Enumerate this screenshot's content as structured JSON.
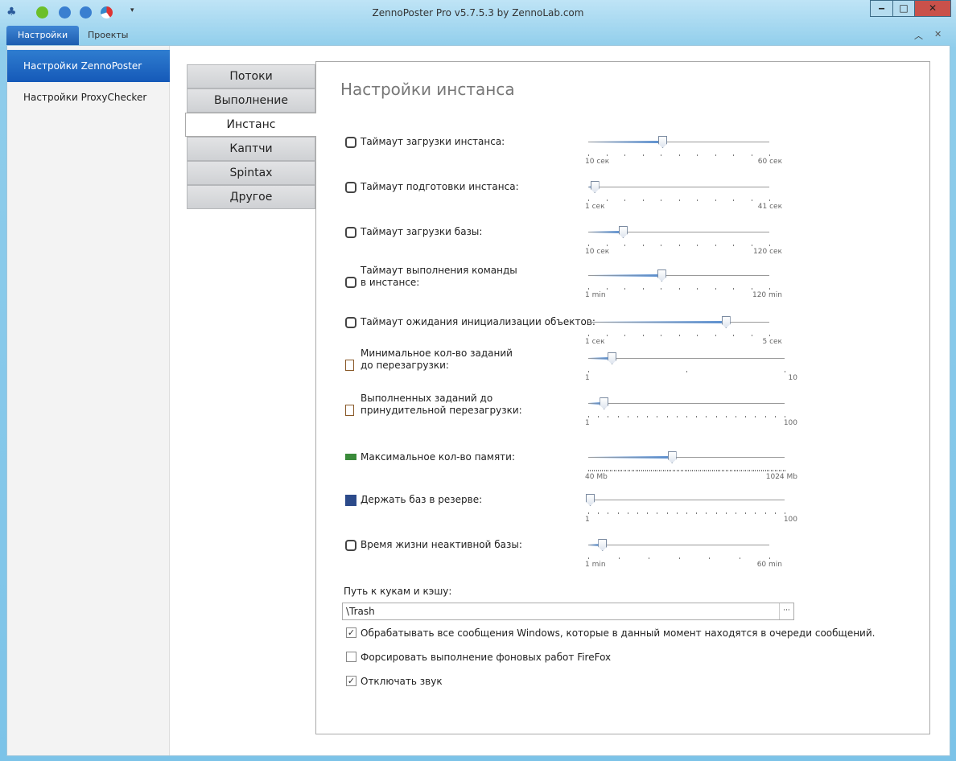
{
  "window": {
    "title": "ZennoPoster Pro v5.7.5.3 by ZennoLab.com",
    "minimize": "‒",
    "maximize": "□",
    "close": "✕"
  },
  "ribbon": {
    "tabs": [
      {
        "label": "Настройки",
        "active": true
      },
      {
        "label": "Проекты",
        "active": false
      }
    ],
    "collapse": "︿",
    "close": "✕"
  },
  "sidebar": {
    "items": [
      {
        "label": "Настройки ZennoPoster",
        "active": true
      },
      {
        "label": "Настройки ProxyChecker",
        "active": false
      }
    ]
  },
  "tabs": [
    {
      "label": "Потоки"
    },
    {
      "label": "Выполнение"
    },
    {
      "label": "Инстанс",
      "active": true
    },
    {
      "label": "Каптчи"
    },
    {
      "label": "Spintax"
    },
    {
      "label": "Другое"
    }
  ],
  "panel": {
    "title": "Настройки инстанса",
    "sliders": [
      {
        "label": "Таймаут загрузки инстанса:",
        "icon": "clock-icon",
        "min_label": "10 сек",
        "max_label": "60 сек",
        "min": 10,
        "max": 60,
        "value": 30
      },
      {
        "label": "Таймаут подготовки инстанса:",
        "icon": "clock-icon",
        "min_label": "1 сек",
        "max_label": "41 сек",
        "min": 1,
        "max": 41,
        "value": 2
      },
      {
        "label": "Таймаут загрузки базы:",
        "icon": "clock-icon",
        "min_label": "10 сек",
        "max_label": "120 сек",
        "min": 10,
        "max": 120,
        "value": 30
      },
      {
        "label": "Таймаут выполнения команды\nв инстансе:",
        "icon": "clock-icon",
        "min_label": "1 min",
        "max_label": "120 min",
        "min": 1,
        "max": 120,
        "value": 48
      },
      {
        "label": "Таймаут ожидания инициализации объектов:",
        "icon": "clock-icon",
        "min_label": "1 сек",
        "max_label": "5 сек",
        "min": 1,
        "max": 5,
        "value": 4
      },
      {
        "label": "Минимальное кол-во заданий\nдо перезагрузки:",
        "icon": "clipboard-icon",
        "min_label": "1",
        "max_label": "10",
        "min": 1,
        "max": 10,
        "value": 2
      },
      {
        "label": "Выполненных заданий до\nпринудительной перезагрузки:",
        "icon": "clipboard-icon",
        "min_label": "1",
        "max_label": "100",
        "min": 1,
        "max": 100,
        "value": 8
      },
      {
        "label": "Максимальное кол-во памяти:",
        "icon": "memory-icon",
        "min_label": "40 Mb",
        "max_label": "1024 Mb",
        "min": 40,
        "max": 1024,
        "value": 450
      },
      {
        "label": "Держать баз в резерве:",
        "icon": "database-icon",
        "min_label": "1",
        "max_label": "100",
        "min": 1,
        "max": 100,
        "value": 1
      },
      {
        "label": "Время жизни неактивной базы:",
        "icon": "clock-icon",
        "min_label": "1 min",
        "max_label": "60 min",
        "min": 1,
        "max": 60,
        "value": 5
      }
    ],
    "path_label": "Путь к кукам и кэшу:",
    "path_value": "\\Trash",
    "browse": "···",
    "checkboxes": [
      {
        "label": "Обрабатывать все сообщения Windows, которые в данный момент находятся в очереди сообщений.",
        "checked": true
      },
      {
        "label": "Форсировать выполнение фоновых работ FireFox",
        "checked": false
      },
      {
        "label": "Отключать звук",
        "checked": true
      }
    ]
  }
}
